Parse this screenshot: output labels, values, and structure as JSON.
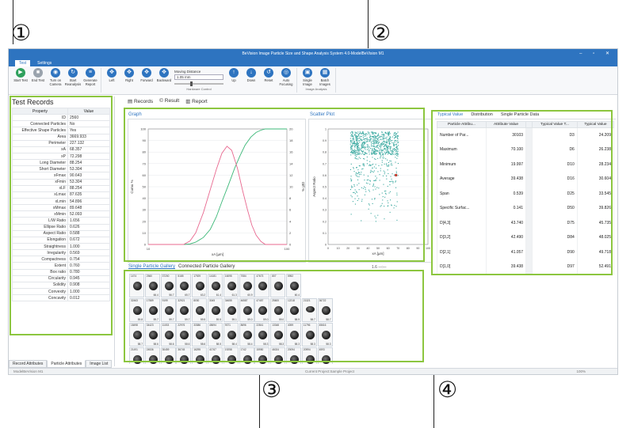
{
  "callouts": [
    "①",
    "②",
    "③",
    "④"
  ],
  "app": {
    "title": "BeVision Image Particle Size and Shape Analysis System 4.0-ModelBeVision M1",
    "menu_tabs": [
      "Test",
      "Settings"
    ],
    "ribbon": {
      "buttons": [
        {
          "label": "Start Test",
          "icon": "play-icon"
        },
        {
          "label": "End Test",
          "icon": "stop-icon"
        },
        {
          "label": "Turn on Camera",
          "icon": "camera-icon"
        },
        {
          "label": "Start Reanalysis",
          "icon": "reanalysis-icon"
        },
        {
          "label": "Generate Report",
          "icon": "report-icon"
        },
        {
          "label": "Left",
          "icon": "move-icon"
        },
        {
          "label": "Right",
          "icon": "move-icon"
        },
        {
          "label": "Forward",
          "icon": "move-icon"
        },
        {
          "label": "Backward",
          "icon": "move-icon"
        }
      ],
      "moving_distance_label": "Moving Distance",
      "moving_distance_value": "1.05 mm",
      "hardware_control_label": "Hardware Control",
      "focus_buttons": [
        {
          "label": "Up",
          "icon": "up-arrow-icon"
        },
        {
          "label": "Down",
          "icon": "down-arrow-icon"
        },
        {
          "label": "Reset",
          "icon": "reset-icon"
        },
        {
          "label": "Auto Focusing",
          "icon": "focus-icon"
        }
      ],
      "image_buttons": [
        {
          "label": "Single Image",
          "icon": "single-image-icon"
        },
        {
          "label": "Batch Images",
          "icon": "batch-images-icon"
        }
      ],
      "image_analysis_label": "Image Analysis"
    },
    "test_records": {
      "title": "Test Records",
      "headers": [
        "Property",
        "Value"
      ],
      "rows": [
        [
          "ID",
          "2560"
        ],
        [
          "Connected Particles",
          "No"
        ],
        [
          "Effective Shape Particles",
          "Yes"
        ],
        [
          "Area",
          "3669.933"
        ],
        [
          "Perimeter",
          "227.132"
        ],
        [
          "xA",
          "68.357"
        ],
        [
          "xP",
          "72.298"
        ],
        [
          "Long Diameter",
          "88.254"
        ],
        [
          "Short Diameter",
          "53.304"
        ],
        [
          "xFmax",
          "90.643"
        ],
        [
          "xFmin",
          "53.304"
        ],
        [
          "xLF",
          "88.254"
        ],
        [
          "xLmax",
          "87.635"
        ],
        [
          "xLmin",
          "54.896"
        ],
        [
          "xMmax",
          "89.648"
        ],
        [
          "xMmin",
          "52.093"
        ],
        [
          "L/W Ratio",
          "1.656"
        ],
        [
          "Ellipse Ratio",
          "0.626"
        ],
        [
          "Aspect Ratio",
          "0.588"
        ],
        [
          "Elongation",
          "0.672"
        ],
        [
          "Straightness",
          "1.000"
        ],
        [
          "Irregularity",
          "0.569"
        ],
        [
          "Compactness",
          "0.754"
        ],
        [
          "Extent",
          "0.760"
        ],
        [
          "Box ratio",
          "0.780"
        ],
        [
          "Circularity",
          "0.945"
        ],
        [
          "Solidity",
          "0.908"
        ],
        [
          "Convexity",
          "1.000"
        ],
        [
          "Concavity",
          "0.012"
        ]
      ],
      "bottom_tabs": [
        "Record Attributes",
        "Particle Attributes",
        "Image List"
      ]
    },
    "doc_tabs": [
      "Records",
      "Result",
      "Report"
    ],
    "graph_title": "Graph",
    "scatter_title": "Scatter Plot",
    "gallery_tabs": [
      "Single Particle Gallery",
      "Connected Particle Gallery"
    ],
    "gallery_zoom": "1.6",
    "gallery_rows": [
      {
        "ids": [
          "1474",
          "2560",
          "37200",
          "5185",
          "17929",
          "14181",
          "16095",
          "7084",
          "47673",
          "807",
          "5952"
        ],
        "vals": [
          "",
          "66.4",
          "56.7",
          "65.7",
          "63.2",
          "61.4",
          "61.3",
          "60.9",
          "",
          "",
          "60.4"
        ]
      },
      {
        "ids": [
          "32463",
          "17589",
          "9199",
          "32921",
          "8030",
          "3045",
          "34655",
          "46587",
          "47457",
          "25600",
          "12218",
          "21321",
          "36722"
        ],
        "vals": [
          "59.8",
          "59.7",
          "59.7",
          "59.7",
          "59.5",
          "59.5",
          "59.1",
          "59.0",
          "59.0",
          "59.0",
          "58.9",
          "58.7",
          "58.7"
        ]
      },
      {
        "ids": [
          "18498",
          "34423",
          "11033",
          "22976",
          "33386",
          "45694",
          "9371",
          "8696",
          "22841",
          "13348",
          "4059",
          "11796",
          "45616"
        ],
        "vals": [
          "58.7",
          "58.6",
          "58.6",
          "58.6",
          "58.6",
          "58.5",
          "58.4",
          "58.4",
          "58.3",
          "58.3",
          "58.3",
          "58.3",
          "58.3"
        ]
      },
      {
        "ids": [
          "21491",
          "24536",
          "30459",
          "36745",
          "16295",
          "41767",
          "19258",
          "1742",
          "15950",
          "46024",
          "20094",
          "20994",
          "4593"
        ],
        "vals": [
          "",
          "",
          "",
          "",
          "",
          "",
          "",
          "",
          "",
          "",
          "",
          "",
          ""
        ]
      }
    ],
    "right_tabs": [
      "Typical Value",
      "Distribution",
      "Single Particle Data"
    ],
    "attr_headers": [
      "Particle Attribu...",
      "Attribute Value",
      "Typical Value T...",
      "Typical Value"
    ],
    "attr_rows": [
      [
        "Number of Par...",
        "30103",
        "D3",
        "24.209"
      ],
      [
        "Maximum",
        "70.100",
        "D6",
        "26.238"
      ],
      [
        "Minimum",
        "19.997",
        "D10",
        "28.234"
      ],
      [
        "Average",
        "39.438",
        "D16",
        "30.604"
      ],
      [
        "Span",
        "0.539",
        "D25",
        "33.545"
      ],
      [
        "Specific Surfac...",
        "0.141",
        "D50",
        "39.826"
      ],
      [
        "D[4,3]",
        "43.740",
        "D75",
        "45.735"
      ],
      [
        "D[3,2]",
        "42.490",
        "D84",
        "48.025"
      ],
      [
        "D[2,1]",
        "41.057",
        "D90",
        "49.718"
      ],
      [
        "D[1,0]",
        "39.438",
        "D97",
        "52.491"
      ]
    ],
    "status": {
      "left": "ModelBeVision M1",
      "center": "Current Project:Sample Project",
      "zoom": "100%"
    },
    "colors": {
      "accent": "#2e74c0",
      "highlight": "#8cc63f",
      "cumu": "#3cb878",
      "diff": "#e8688f",
      "scatter": "#3aa9a0"
    }
  },
  "chart_data": [
    {
      "type": "line",
      "title": "Graph",
      "xlabel": "xA [µm]",
      "ylabel": "Cumu %",
      "y2label": "Diff %",
      "xlim": [
        10,
        100
      ],
      "ylim": [
        0,
        100
      ],
      "y2lim": [
        0,
        20
      ],
      "xscale": "log",
      "x_ticks": [
        "10",
        "100"
      ],
      "y_ticks": [
        "0",
        "10",
        "20",
        "30",
        "40",
        "50",
        "60",
        "70",
        "80",
        "90",
        "100"
      ],
      "y2_ticks": [
        "0",
        "2",
        "4",
        "6",
        "8",
        "10",
        "12",
        "14",
        "16",
        "18",
        "20"
      ],
      "series": [
        {
          "axis": "y",
          "x": [
            10,
            18,
            20,
            22,
            25,
            28,
            31,
            34,
            38,
            42,
            46,
            50,
            55,
            60,
            65,
            70,
            100
          ],
          "y": [
            0,
            0,
            0.5,
            2,
            6,
            13,
            24,
            37,
            52,
            66,
            77,
            86,
            93,
            97,
            99,
            100,
            100
          ]
        },
        {
          "axis": "y2",
          "x": [
            10,
            18,
            20,
            22,
            25,
            28,
            31,
            34,
            37,
            40,
            44,
            48,
            52,
            56,
            60,
            65,
            70,
            100
          ],
          "y": [
            0,
            0,
            0.6,
            2,
            5.5,
            9.5,
            13,
            15.8,
            17,
            16.3,
            13.2,
            9.3,
            6,
            3.3,
            1.6,
            0.5,
            0,
            0
          ]
        }
      ],
      "grid": true
    },
    {
      "type": "scatter",
      "title": "Scatter Plot",
      "xlabel": "xA [µm]",
      "ylabel": "Aspect Ratio",
      "xlim": [
        0,
        100
      ],
      "ylim": [
        0,
        1
      ],
      "x_ticks": [
        "0",
        "10",
        "20",
        "30",
        "40",
        "50",
        "60",
        "70",
        "80",
        "90",
        "100"
      ],
      "y_ticks": [
        "0",
        "0.1",
        "0.2",
        "0.3",
        "0.4",
        "0.5",
        "0.6",
        "0.7",
        "0.8",
        "0.9",
        "1"
      ],
      "description_points": {
        "x_range": [
          20,
          70
        ],
        "y_range": [
          0.2,
          1.0
        ],
        "dense_above": 0.75
      },
      "highlight_point": {
        "x": 68,
        "y": 0.6
      },
      "grid": true
    }
  ]
}
